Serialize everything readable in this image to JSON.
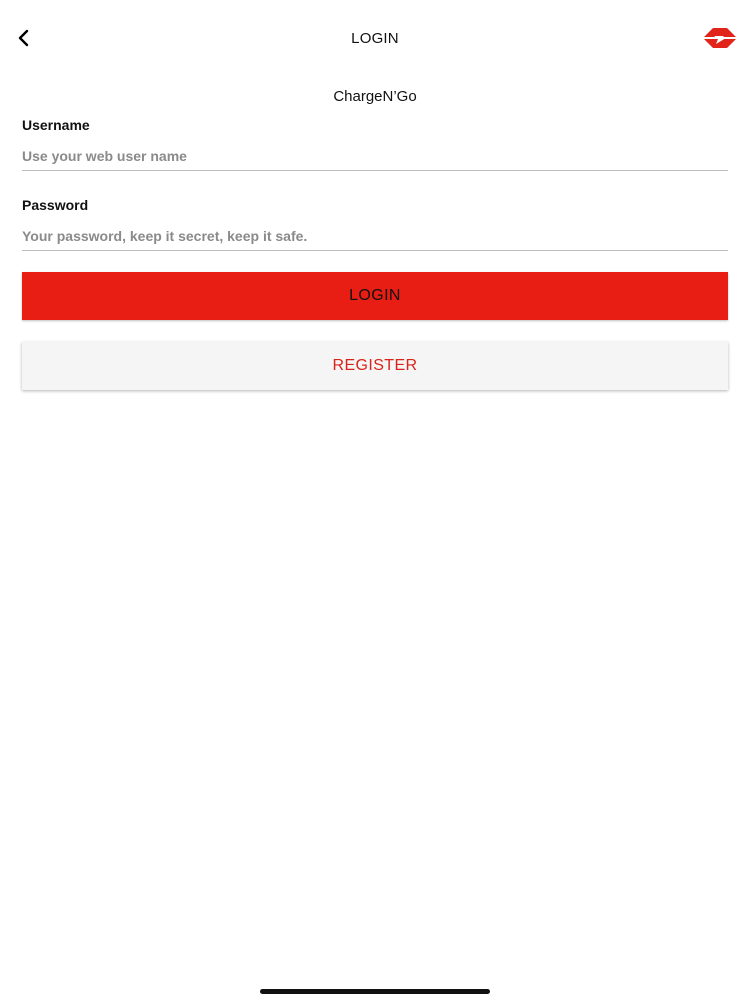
{
  "nav": {
    "title": "LOGIN",
    "back_icon": "chevron-left-icon",
    "logo_icon": "chargengo-logo-icon"
  },
  "app": {
    "name": "ChargeN’Go"
  },
  "form": {
    "username": {
      "label": "Username",
      "placeholder": "Use your web user name",
      "value": ""
    },
    "password": {
      "label": "Password",
      "placeholder": "Your password, keep it secret, keep it safe.",
      "value": ""
    }
  },
  "buttons": {
    "login_label": "LOGIN",
    "register_label": "REGISTER"
  },
  "colors": {
    "accent_red": "#e81e14",
    "register_text": "#d8231b",
    "register_bg": "#f6f5f5"
  }
}
